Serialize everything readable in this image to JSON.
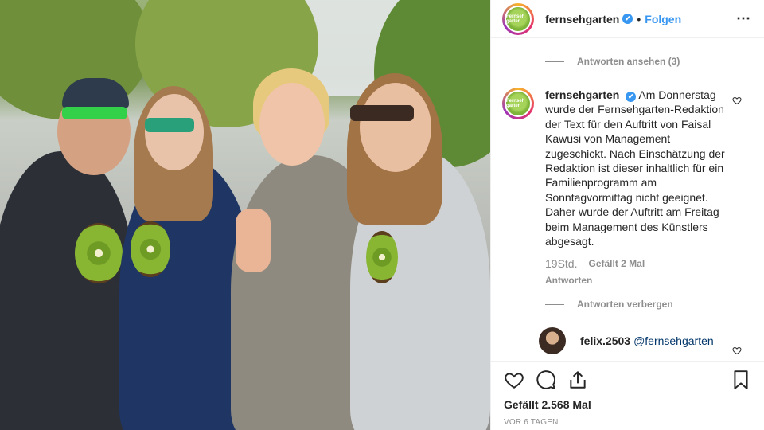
{
  "header": {
    "username": "fernsehgarten",
    "verified_mark": "✔",
    "separator": "•",
    "follow_label": "Folgen",
    "more_icon": "⋯",
    "avatar_text": "Fernseh garten"
  },
  "thread": {
    "view_replies_label": "Antworten ansehen (3)",
    "caption": {
      "username": "fernsehgarten",
      "text": "Am Donnerstag wurde der Fernsehgarten-Redaktion der Text für den Auftritt von Faisal Kawusi von Management zugeschickt. Nach Einschätzung der Redaktion ist dieser inhaltlich für ein Familienprogramm am Sonntagvormittag nicht geeignet. Daher wurde der Auftritt am Freitag beim Management des Künstlers abgesagt.",
      "time": "19Std.",
      "likes": "Gefällt 2 Mal",
      "reply_label": "Antworten"
    },
    "hide_replies_label": "Antworten verbergen",
    "reply": {
      "username": "felix.2503",
      "mention": "@fernsehgarten"
    }
  },
  "actions": {
    "like_icon": "heart-icon",
    "comment_icon": "comment-icon",
    "share_icon": "share-icon",
    "save_icon": "bookmark-icon",
    "likes_text": "Gefällt 2.568 Mal",
    "date_text": "VOR 6 TAGEN"
  },
  "colors": {
    "accent": "#3897f0",
    "muted": "#8e8e8e",
    "text": "#262626"
  }
}
